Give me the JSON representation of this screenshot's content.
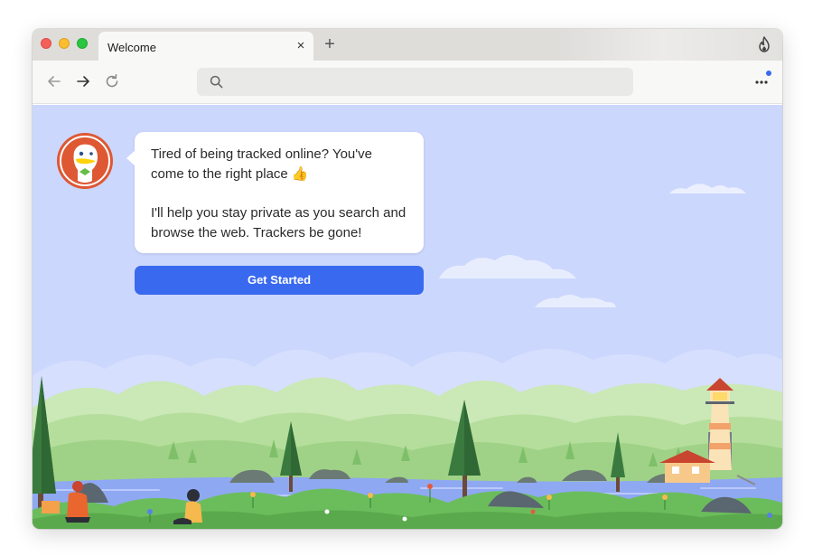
{
  "window": {
    "tab": {
      "title": "Welcome",
      "close_glyph": "×"
    },
    "new_tab_glyph": "+",
    "icons": [
      "fire-icon",
      "back-arrow-icon",
      "forward-arrow-icon",
      "reload-icon",
      "search-icon",
      "more-menu-icon",
      "duckduckgo-logo"
    ]
  },
  "toolbar": {
    "address": {
      "value": "",
      "placeholder": ""
    },
    "menu_notification": true
  },
  "welcome": {
    "message_line1": "Tired of being tracked online? You've come to the right place 👍",
    "message_line2": "I'll help you stay private as you search and browse the web. Trackers be gone!",
    "cta_label": "Get Started"
  },
  "colors": {
    "accent": "#3969ef",
    "page_background": "#ccd7fd",
    "brand_orange": "#de5833"
  }
}
